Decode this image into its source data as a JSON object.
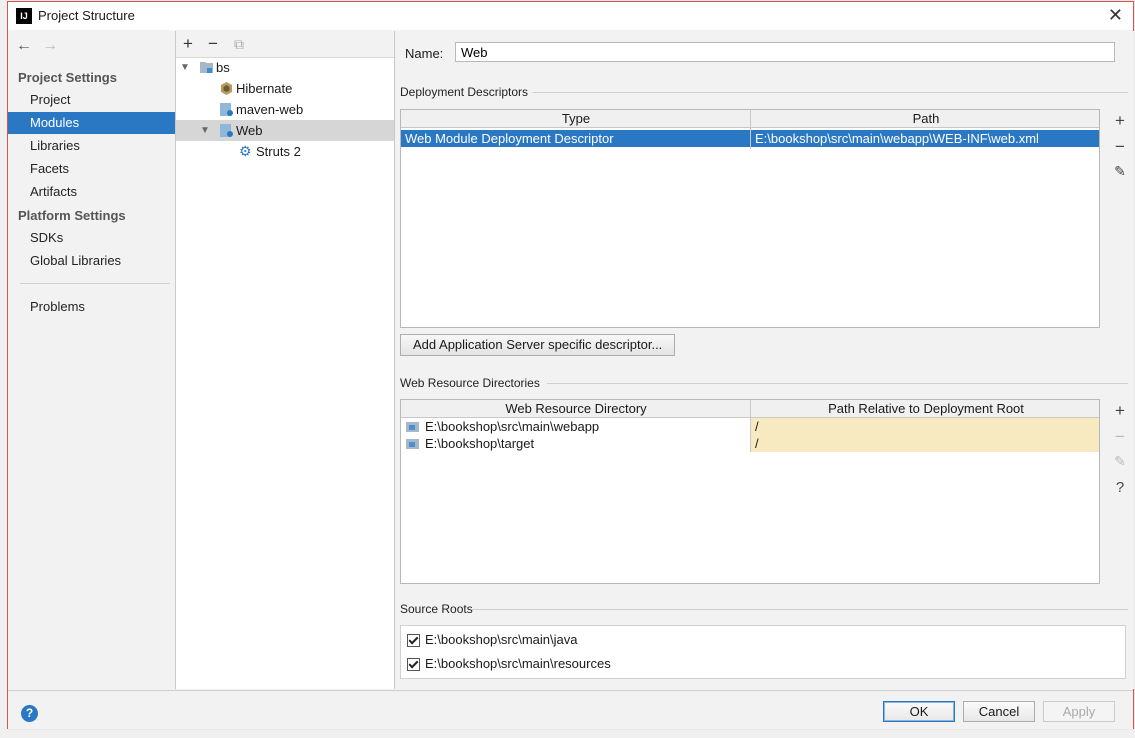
{
  "window": {
    "title": "Project Structure"
  },
  "left_nav": {
    "project_settings_header": "Project Settings",
    "platform_settings_header": "Platform Settings",
    "items": [
      {
        "label": "Project"
      },
      {
        "label": "Modules",
        "selected": true
      },
      {
        "label": "Libraries"
      },
      {
        "label": "Facets"
      },
      {
        "label": "Artifacts"
      },
      {
        "label": "SDKs"
      },
      {
        "label": "Global Libraries"
      },
      {
        "label": "Problems"
      }
    ]
  },
  "tree": {
    "nodes": [
      {
        "label": "bs",
        "icon": "folder-module-icon"
      },
      {
        "label": "Hibernate",
        "icon": "hibernate-icon"
      },
      {
        "label": "maven-web",
        "icon": "web-facet-icon"
      },
      {
        "label": "Web",
        "icon": "web-facet-icon",
        "selected": true
      },
      {
        "label": "Struts 2",
        "icon": "gear-icon"
      }
    ]
  },
  "content": {
    "name_label": "Name:",
    "name_value": "Web",
    "deployment_descriptors": {
      "title": "Deployment Descriptors",
      "columns": [
        "Type",
        "Path"
      ],
      "rows": [
        {
          "type": "Web Module Deployment Descriptor",
          "path": "E:\\bookshop\\src\\main\\webapp\\WEB-INF\\web.xml"
        }
      ]
    },
    "add_server_descriptor_button": "Add Application Server specific descriptor...",
    "web_resource_dirs": {
      "title": "Web Resource Directories",
      "columns": [
        "Web Resource Directory",
        "Path Relative to Deployment Root"
      ],
      "rows": [
        {
          "dir": "E:\\bookshop\\src\\main\\webapp",
          "rel": "/"
        },
        {
          "dir": "E:\\bookshop\\target",
          "rel": "/"
        }
      ]
    },
    "source_roots": {
      "title": "Source Roots",
      "items": [
        {
          "label": "E:\\bookshop\\src\\main\\java",
          "checked": true
        },
        {
          "label": "E:\\bookshop\\src\\main\\resources",
          "checked": true
        }
      ]
    }
  },
  "buttons": {
    "ok": "OK",
    "cancel": "Cancel",
    "apply": "Apply"
  }
}
